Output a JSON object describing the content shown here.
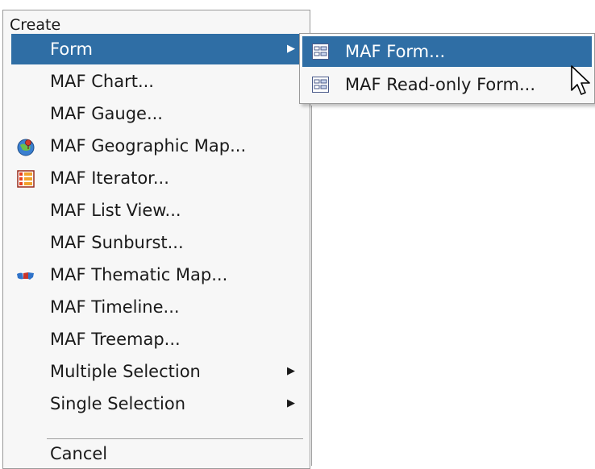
{
  "menu": {
    "header": "Create",
    "items": [
      {
        "label": "Form",
        "icon": "",
        "has_submenu": true,
        "highlighted": true
      },
      {
        "label": "MAF Chart...",
        "icon": "",
        "has_submenu": false
      },
      {
        "label": "MAF Gauge...",
        "icon": "",
        "has_submenu": false
      },
      {
        "label": "MAF Geographic Map...",
        "icon": "globe-map-icon",
        "has_submenu": false
      },
      {
        "label": "MAF Iterator...",
        "icon": "iterator-icon",
        "has_submenu": false
      },
      {
        "label": "MAF List View...",
        "icon": "",
        "has_submenu": false
      },
      {
        "label": "MAF Sunburst...",
        "icon": "",
        "has_submenu": false
      },
      {
        "label": "MAF Thematic Map...",
        "icon": "thematic-map-icon",
        "has_submenu": false
      },
      {
        "label": "MAF Timeline...",
        "icon": "",
        "has_submenu": false
      },
      {
        "label": "MAF Treemap...",
        "icon": "",
        "has_submenu": false
      },
      {
        "label": "Multiple Selection",
        "icon": "",
        "has_submenu": true
      },
      {
        "label": "Single Selection",
        "icon": "",
        "has_submenu": true
      }
    ],
    "cancel_label": "Cancel",
    "submenu_arrow": "▶"
  },
  "submenu": {
    "items": [
      {
        "label": "MAF Form...",
        "icon": "form-icon",
        "highlighted": true
      },
      {
        "label": "MAF Read-only Form...",
        "icon": "form-icon",
        "highlighted": false
      }
    ]
  },
  "colors": {
    "highlight": "#2f6ea5",
    "menu_bg": "#f7f7f7",
    "border": "#9a9a9a"
  }
}
